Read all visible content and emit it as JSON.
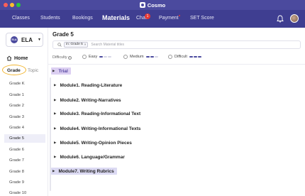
{
  "window": {
    "title": "Cosmo",
    "traffic_lights": [
      "#ff5f57",
      "#febc2e",
      "#28c840"
    ],
    "colors": {
      "titlebar": "#4b4a9e",
      "navbar": "#3f3e91",
      "accent": "#4b4a9e",
      "highlight": "#dcdaf3",
      "badge": "#e53935",
      "annotation_circle": "#f2b531"
    }
  },
  "nav": {
    "items": [
      {
        "label": "Classes"
      },
      {
        "label": "Students"
      },
      {
        "label": "Bookings"
      },
      {
        "label": "Materials"
      },
      {
        "label": "Chat"
      },
      {
        "label": "Payment"
      },
      {
        "label": "SET Score"
      }
    ],
    "chat_badge": "1",
    "icons": {
      "notifications": "bell-icon",
      "profile": "avatar"
    }
  },
  "sidebar": {
    "subject": {
      "badge": "ELA",
      "label": "ELA"
    },
    "home_label": "Home",
    "tabs": {
      "grade": "Grade",
      "topic": "Topic"
    },
    "grades": [
      "Grade K",
      "Grade 1",
      "Grade 2",
      "Grade 3",
      "Grade 4",
      "Grade 5",
      "Grade 6",
      "Grade 7",
      "Grade 8",
      "Grade 9",
      "Grade 10"
    ],
    "selected_grade": "Grade 5"
  },
  "main": {
    "title": "Grade 5",
    "search": {
      "chip_label": "in: Grade 5",
      "placeholder": "Search Material titles",
      "value": ""
    },
    "difficulty": {
      "label": "Difficulty",
      "options": [
        {
          "label": "Easy",
          "level": 1
        },
        {
          "label": "Medium",
          "level": 2
        },
        {
          "label": "Difficult",
          "level": 3
        }
      ]
    },
    "modules": [
      {
        "label": "Trial",
        "highlighted": true
      },
      {
        "label": "Module1. Reading-Literature",
        "highlighted": false
      },
      {
        "label": "Module2. Writing-Narratives",
        "highlighted": false
      },
      {
        "label": "Module3. Reading-Informational Text",
        "highlighted": false
      },
      {
        "label": "Module4. Writing-Informational Texts",
        "highlighted": false
      },
      {
        "label": "Module5. Writing-Opinion Pieces",
        "highlighted": false
      },
      {
        "label": "Module6. Language/Grammar",
        "highlighted": false
      },
      {
        "label": "Module7. Writing Rubrics",
        "highlighted": true
      }
    ]
  }
}
